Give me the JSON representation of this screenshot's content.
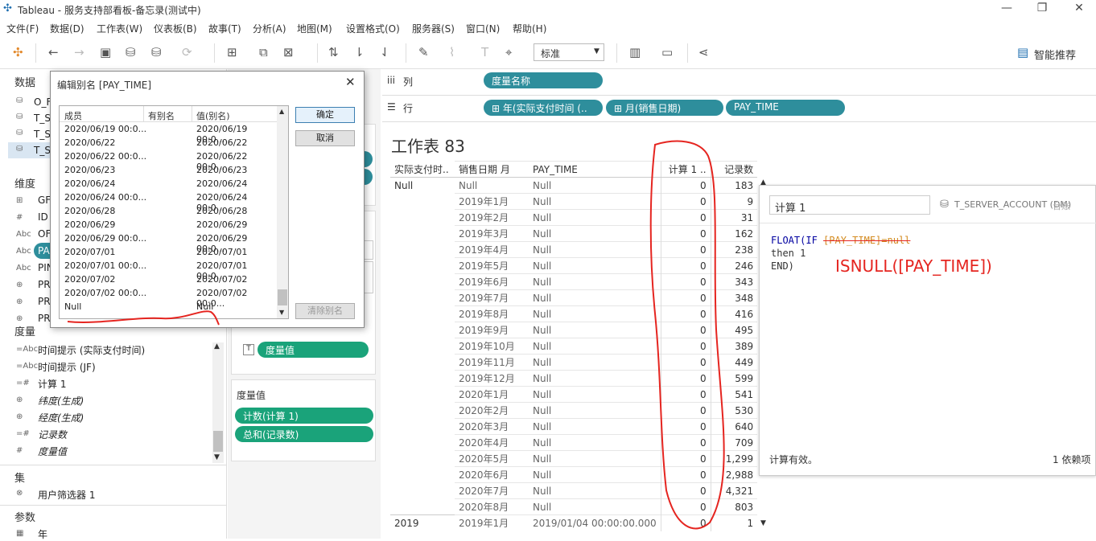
{
  "window": {
    "title": "Tableau - 服务支持部看板-备忘录(测试中)",
    "min": "—",
    "restore": "❐",
    "close": "✕"
  },
  "menu": [
    "文件(F)",
    "数据(D)",
    "工作表(W)",
    "仪表板(B)",
    "故事(T)",
    "分析(A)",
    "地图(M)",
    "设置格式(O)",
    "服务器(S)",
    "窗口(N)",
    "帮助(H)"
  ],
  "toolbar": {
    "fit_select": "标准",
    "smart": "智能推荐"
  },
  "left": {
    "data_header": "数据",
    "datasources": [
      "O_F",
      "T_S",
      "T_S",
      "T_S",
      "T_S"
    ],
    "dims_header": "维度",
    "dims": [
      {
        "icon": "⊞",
        "label": "GF"
      },
      {
        "icon": "#",
        "label": "ID"
      },
      {
        "icon": "Abc",
        "label": "OF"
      },
      {
        "icon": "Abc",
        "label": "PA"
      },
      {
        "icon": "Abc",
        "label": "PIN"
      },
      {
        "icon": "⊕",
        "label": "PR"
      },
      {
        "icon": "⊕",
        "label": "PR"
      },
      {
        "icon": "⊕",
        "label": "PR"
      }
    ],
    "measures_header": "度量",
    "measures": [
      {
        "icon": "=Abc",
        "label": "时间提示 (实际支付时间)"
      },
      {
        "icon": "=Abc",
        "label": "时间提示 (JF)"
      },
      {
        "icon": "=#",
        "label": "计算 1"
      },
      {
        "icon": "⊕",
        "label": "纬度(生成)"
      },
      {
        "icon": "⊕",
        "label": "经度(生成)"
      },
      {
        "icon": "=#",
        "label": "记录数"
      },
      {
        "icon": "#",
        "label": "度量值"
      }
    ],
    "sets_header": "集",
    "sets": [
      {
        "icon": "⊗",
        "label": "用户筛选器 1"
      }
    ],
    "params_header": "参数",
    "params": [
      {
        "icon": "▦",
        "label": "年"
      }
    ]
  },
  "mid": {
    "marks_pill": "度量值",
    "measure_values_header": "度量值",
    "mv_pills": [
      "计数(计算 1)",
      "总和(记录数)"
    ]
  },
  "shelves": {
    "columns_label": "列",
    "rows_label": "行",
    "columns": [
      "度量名称"
    ],
    "rows": [
      "⊞ 年(实际支付时间 (..",
      "⊞ 月(销售日期)",
      "PAY_TIME"
    ]
  },
  "sheet": {
    "title": "工作表 83",
    "headers": [
      "实际支付时..",
      "销售日期 月",
      "PAY_TIME",
      "计算 1 ..",
      "记录数"
    ],
    "rows": [
      [
        "Null",
        "Null",
        "Null",
        "0",
        "183"
      ],
      [
        "",
        "2019年1月",
        "Null",
        "0",
        "9"
      ],
      [
        "",
        "2019年2月",
        "Null",
        "0",
        "31"
      ],
      [
        "",
        "2019年3月",
        "Null",
        "0",
        "162"
      ],
      [
        "",
        "2019年4月",
        "Null",
        "0",
        "238"
      ],
      [
        "",
        "2019年5月",
        "Null",
        "0",
        "246"
      ],
      [
        "",
        "2019年6月",
        "Null",
        "0",
        "343"
      ],
      [
        "",
        "2019年7月",
        "Null",
        "0",
        "348"
      ],
      [
        "",
        "2019年8月",
        "Null",
        "0",
        "416"
      ],
      [
        "",
        "2019年9月",
        "Null",
        "0",
        "495"
      ],
      [
        "",
        "2019年10月",
        "Null",
        "0",
        "389"
      ],
      [
        "",
        "2019年11月",
        "Null",
        "0",
        "449"
      ],
      [
        "",
        "2019年12月",
        "Null",
        "0",
        "599"
      ],
      [
        "",
        "2020年1月",
        "Null",
        "0",
        "541"
      ],
      [
        "",
        "2020年2月",
        "Null",
        "0",
        "530"
      ],
      [
        "",
        "2020年3月",
        "Null",
        "0",
        "640"
      ],
      [
        "",
        "2020年4月",
        "Null",
        "0",
        "709"
      ],
      [
        "",
        "2020年5月",
        "Null",
        "0",
        "1,299"
      ],
      [
        "",
        "2020年6月",
        "Null",
        "0",
        "2,988"
      ],
      [
        "",
        "2020年7月",
        "Null",
        "0",
        "4,321"
      ],
      [
        "",
        "2020年8月",
        "Null",
        "0",
        "803"
      ],
      [
        "2019",
        "2019年1月",
        "2019/01/04 00:00:00.000",
        "0",
        "1"
      ]
    ]
  },
  "calc": {
    "name": "计算 1",
    "source": "T_SERVER_ACCOUNT (DM)",
    "source_suffix": "台账",
    "code_line1_a": "FLOAT(IF ",
    "code_line1_struck": "[PAY_TIME]=null",
    "code_line2": "then 1",
    "code_line3": "END)",
    "annotation": "ISNULL([PAY_TIME])",
    "status": "计算有效。",
    "deps": "1 依赖项"
  },
  "dialog": {
    "title": "编辑别名 [PAY_TIME]",
    "close": "✕",
    "col_member": "成员",
    "col_has_alias": "有别名",
    "col_value": "值(别名)",
    "rows": [
      [
        "2020/06/19 00:0...",
        "2020/06/19 00:0..."
      ],
      [
        "2020/06/22",
        "2020/06/22"
      ],
      [
        "2020/06/22 00:0...",
        "2020/06/22 00:0..."
      ],
      [
        "2020/06/23",
        "2020/06/23"
      ],
      [
        "2020/06/24",
        "2020/06/24"
      ],
      [
        "2020/06/24 00:0...",
        "2020/06/24 00:0..."
      ],
      [
        "2020/06/28",
        "2020/06/28"
      ],
      [
        "2020/06/29",
        "2020/06/29"
      ],
      [
        "2020/06/29 00:0...",
        "2020/06/29 00:0..."
      ],
      [
        "2020/07/01",
        "2020/07/01"
      ],
      [
        "2020/07/01 00:0...",
        "2020/07/01 00:0..."
      ],
      [
        "2020/07/02",
        "2020/07/02"
      ],
      [
        "2020/07/02 00:0...",
        "2020/07/02 00:0..."
      ],
      [
        "Null",
        "Null"
      ]
    ],
    "ok": "确定",
    "cancel": "取消",
    "clear": "清除别名"
  }
}
